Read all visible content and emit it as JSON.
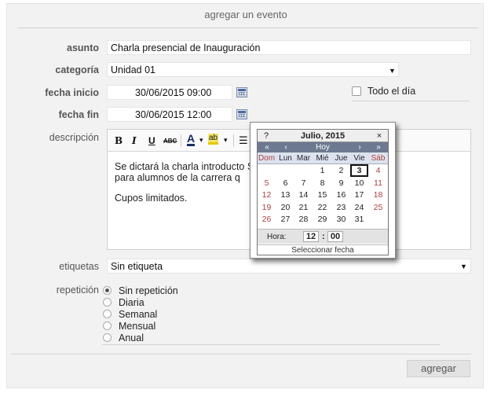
{
  "form": {
    "title": "agregar un evento",
    "asunto": {
      "label": "asunto",
      "value": "Charla presencial de Inauguración"
    },
    "categoria": {
      "label": "categoría",
      "value": "Unidad 01",
      "caret": "▼"
    },
    "fecha_inicio": {
      "label": "fecha inicio",
      "value": "30/06/2015 09:00"
    },
    "fecha_fin": {
      "label": "fecha fin",
      "value": "30/06/2015 12:00"
    },
    "todo_el_dia": {
      "label": "Todo el día",
      "checked": false
    },
    "descripcion": {
      "label": "descripción",
      "toolbar": {
        "bold": "B",
        "italic": "I",
        "underline": "U",
        "strike": "ABC",
        "font_color": "A",
        "highlight": "ab",
        "caret": "▾",
        "list": "☰"
      },
      "paragraphs": [
        "Se dictará la charla introducto  Sistemas",
        "para alumnos de la carrera q",
        "Cupos limitados."
      ]
    },
    "etiquetas": {
      "label": "etiquetas",
      "value": "Sin etiqueta",
      "caret": "▼"
    },
    "repeticion": {
      "label": "repetición",
      "options": [
        "Sin repetición",
        "Diaria",
        "Semanal",
        "Mensual",
        "Anual"
      ],
      "selected": "Sin repetición"
    },
    "submit_label": "agregar"
  },
  "calendar": {
    "help": "?",
    "close": "×",
    "month_label": "Julio, 2015",
    "nav": {
      "prev_year": "«",
      "prev_month": "‹",
      "today": "Hoy",
      "next_month": "›",
      "next_year": "»"
    },
    "day_names": [
      "Dom",
      "Lun",
      "Mar",
      "Mié",
      "Jue",
      "Vie",
      "Sáb"
    ],
    "weeks": [
      [
        "",
        "",
        "",
        "1",
        "2",
        "3",
        "4"
      ],
      [
        "5",
        "6",
        "7",
        "8",
        "9",
        "10",
        "11"
      ],
      [
        "12",
        "13",
        "14",
        "15",
        "16",
        "17",
        "18"
      ],
      [
        "19",
        "20",
        "21",
        "22",
        "23",
        "24",
        "25"
      ],
      [
        "26",
        "27",
        "28",
        "29",
        "30",
        "31",
        ""
      ]
    ],
    "selected_day": "3",
    "time": {
      "label": "Hora:",
      "hour": "12",
      "minute": "00"
    },
    "footer": "Seleccionar fecha",
    "weekend_color": "#b04040"
  }
}
